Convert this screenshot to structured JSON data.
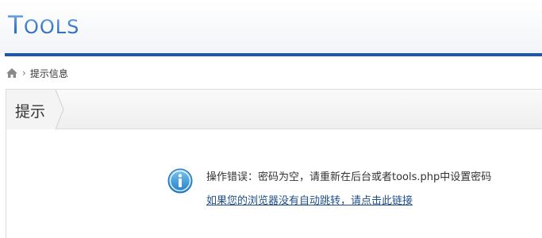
{
  "header": {
    "logo_first": "T",
    "logo_rest": "OOLS"
  },
  "breadcrumb": {
    "icon": "home-icon",
    "current": "提示信息"
  },
  "panel": {
    "title": "提示"
  },
  "message": {
    "icon": "info-icon",
    "text": "操作错误：密码为空，请重新在后台或者tools.php中设置密码",
    "link_text": "如果您的浏览器没有自动跳转，请点击此链接"
  },
  "colors": {
    "accent_bar": "#1a57b5",
    "logo_blue": "#3b79c9",
    "link": "#1f4f8a",
    "info_icon": "#2e8fd6"
  }
}
